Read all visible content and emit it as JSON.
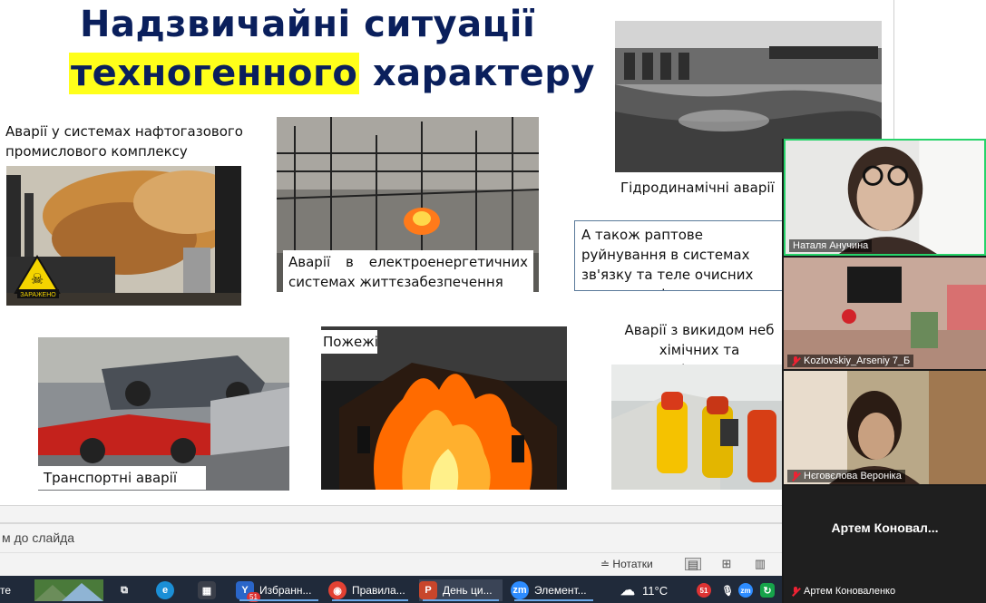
{
  "slide": {
    "title_line1": "Надзвичайні ситуації",
    "title_line2_highlight": "техногенного",
    "title_line2_rest": " характеру",
    "captions": {
      "oil_gas": "Аварії у системах нафтогазового промислового комплексу",
      "power": "Аварії в електроенергетичних системах життєзабезпечення",
      "hydro": "Гідродинамічні аварії",
      "also": "А також раптове руйнування в системах зв'язку та теле очисних споруд, та ін.",
      "fires": "Пожежі",
      "chemical": "Аварії з викидом неб хімічних та радіоактивн",
      "transport": "Транспортні аварії"
    },
    "hazard_sign": "ЗАРАЖЕНО"
  },
  "notes": {
    "placeholder": "м до слайда"
  },
  "statusbar": {
    "notes_label": "Нотатки"
  },
  "taskbar": {
    "items": [
      {
        "label": "те"
      },
      {
        "label": "Избранн...",
        "badge": "51"
      },
      {
        "label": "Правила..."
      },
      {
        "label": "День ци..."
      },
      {
        "label": "Элемент..."
      }
    ],
    "weather": "11°C",
    "tray_badge": "51",
    "zoom_icon": "zm"
  },
  "zoom": {
    "participants": [
      {
        "name": "Наталя Анучина",
        "muted": false
      },
      {
        "name": "Kozlovskiy_Arseniy 7_Б",
        "muted": true
      },
      {
        "name": "Нєговєлова Вероніка",
        "muted": true
      },
      {
        "name": "Артем Коноваленко",
        "muted": true,
        "display_name": "Артем Коновал..."
      }
    ]
  },
  "colors": {
    "title": "#0a1f5c",
    "highlight": "#ffff1a",
    "taskbar": "#202a3a",
    "active_speaker": "#27d36a"
  }
}
